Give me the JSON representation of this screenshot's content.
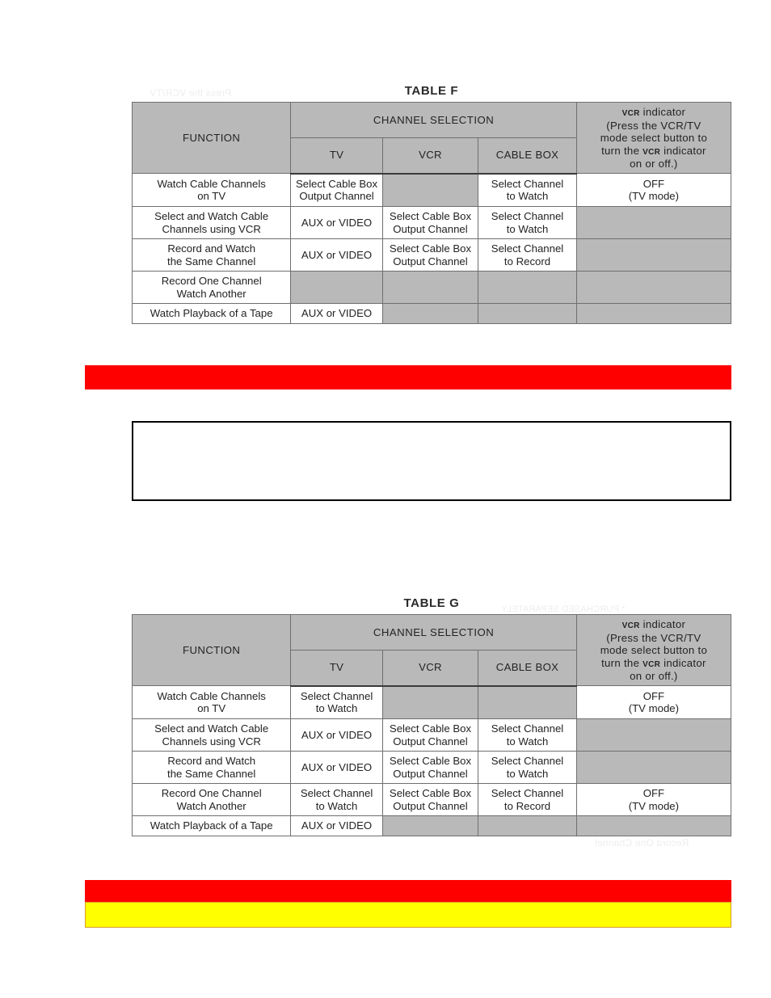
{
  "page": {
    "background_color": "#ffffff",
    "bar_red_color": "#fe0000",
    "bar_yellow_color": "#ffff00",
    "header_shade_color": "#b9b9b9",
    "grid_line_color": "#6f6f6f"
  },
  "shared_headers": {
    "function": "FUNCTION",
    "channel_selection": "CHANNEL SELECTION",
    "tv": "TV",
    "vcr": "VCR",
    "cable_box": "CABLE BOX",
    "indicator_line1_small": "VCR",
    "indicator_line1_bold": "indicator",
    "indicator_line2": "(Press the VCR/TV",
    "indicator_line3": "mode select button to",
    "indicator_line4a": "turn the",
    "indicator_line4b": "VCR",
    "indicator_line4c": "indicator",
    "indicator_line5": "on or off.)"
  },
  "table_f": {
    "title": "TABLE F",
    "rows": [
      {
        "function": [
          "Watch Cable Channels",
          "on TV"
        ],
        "tv": [
          "Select Cable Box",
          "Output Channel"
        ],
        "vcr": [],
        "cable_box": [
          "Select Channel",
          "to Watch"
        ],
        "indicator": [
          "OFF",
          "(TV mode)"
        ]
      },
      {
        "function": [
          "Select and Watch Cable",
          "Channels using VCR"
        ],
        "tv": [
          "AUX or VIDEO"
        ],
        "vcr": [
          "Select Cable Box",
          "Output Channel"
        ],
        "cable_box": [
          "Select Channel",
          "to Watch"
        ],
        "indicator": []
      },
      {
        "function": [
          "Record and Watch",
          "the Same Channel"
        ],
        "tv": [
          "AUX or VIDEO"
        ],
        "vcr": [
          "Select Cable Box",
          "Output Channel"
        ],
        "cable_box": [
          "Select Channel",
          "to Record"
        ],
        "indicator": []
      },
      {
        "function": [
          "Record One Channel",
          "Watch Another"
        ],
        "tv": [],
        "vcr": [],
        "cable_box": [],
        "indicator": []
      },
      {
        "function": [
          "Watch Playback of a Tape"
        ],
        "tv": [
          "AUX or VIDEO"
        ],
        "vcr": [],
        "cable_box": [],
        "indicator": []
      }
    ]
  },
  "table_g": {
    "title": "TABLE G",
    "rows": [
      {
        "function": [
          "Watch Cable Channels",
          "on TV"
        ],
        "tv": [
          "Select Channel",
          "to Watch"
        ],
        "vcr": [],
        "cable_box": [],
        "indicator": [
          "OFF",
          "(TV mode)"
        ]
      },
      {
        "function": [
          "Select and Watch Cable",
          "Channels using VCR"
        ],
        "tv": [
          "AUX or VIDEO"
        ],
        "vcr": [
          "Select Cable Box",
          "Output Channel"
        ],
        "cable_box": [
          "Select Channel",
          "to Watch"
        ],
        "indicator": []
      },
      {
        "function": [
          "Record and Watch",
          "the Same Channel"
        ],
        "tv": [
          "AUX or VIDEO"
        ],
        "vcr": [
          "Select Cable Box",
          "Output Channel"
        ],
        "cable_box": [
          "Select Channel",
          "to Watch"
        ],
        "indicator": []
      },
      {
        "function": [
          "Record One Channel",
          "Watch Another"
        ],
        "tv": [
          "Select Channel",
          "to Watch"
        ],
        "vcr": [
          "Select Cable Box",
          "Output Channel"
        ],
        "cable_box": [
          "Select Channel",
          "to Record"
        ],
        "indicator": [
          "OFF",
          "(TV mode)"
        ]
      },
      {
        "function": [
          "Watch Playback of a Tape"
        ],
        "tv": [
          "AUX or VIDEO"
        ],
        "vcr": [],
        "cable_box": [],
        "indicator": []
      }
    ]
  },
  "redaction_bars": {
    "bar_upper_red": "",
    "bar_lower_red": "",
    "bar_lower_yellow": ""
  },
  "empty_box": {
    "content": ""
  }
}
